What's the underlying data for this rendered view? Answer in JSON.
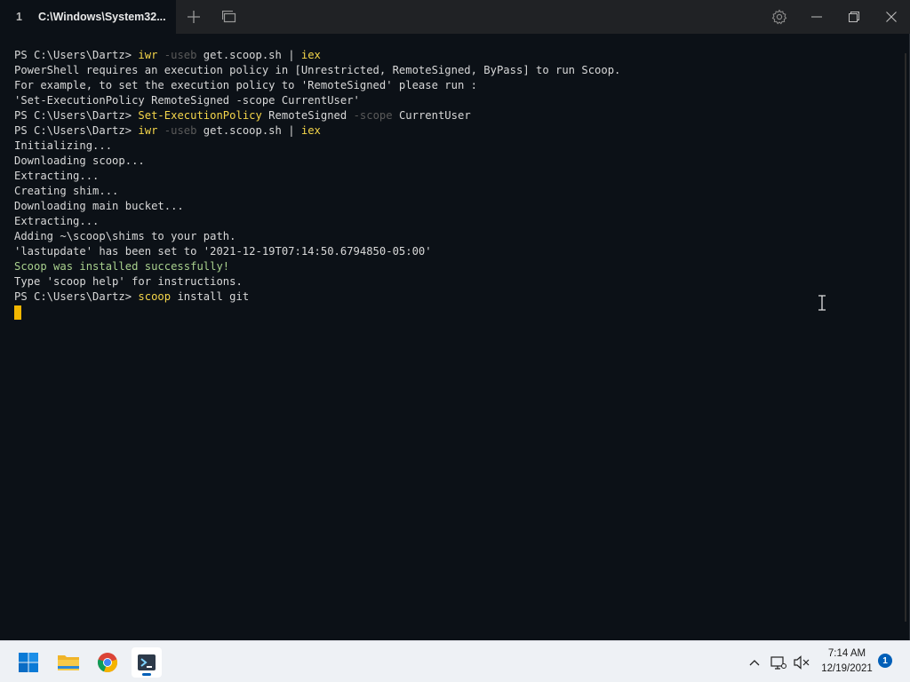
{
  "window": {
    "tab": {
      "index": "1",
      "title": "C:\\Windows\\System32..."
    }
  },
  "terminal": {
    "lines": [
      [
        {
          "t": "PS C:\\Users\\Dartz> ",
          "c": "white"
        },
        {
          "t": "iwr",
          "c": "cmd"
        },
        {
          "t": " -useb",
          "c": "grey"
        },
        {
          "t": " get.scoop.sh | ",
          "c": "white"
        },
        {
          "t": "iex",
          "c": "cmd"
        }
      ],
      [
        {
          "t": "PowerShell requires an execution policy in [Unrestricted, RemoteSigned, ByPass] to run Scoop.",
          "c": "white"
        }
      ],
      [
        {
          "t": "For example, to set the execution policy to 'RemoteSigned' please run :",
          "c": "white"
        }
      ],
      [
        {
          "t": "'Set-ExecutionPolicy RemoteSigned -scope CurrentUser'",
          "c": "white"
        }
      ],
      [
        {
          "t": "PS C:\\Users\\Dartz> ",
          "c": "white"
        },
        {
          "t": "Set-ExecutionPolicy",
          "c": "cmd"
        },
        {
          "t": " RemoteSigned ",
          "c": "white"
        },
        {
          "t": "-scope",
          "c": "grey"
        },
        {
          "t": " CurrentUser",
          "c": "white"
        }
      ],
      [
        {
          "t": "PS C:\\Users\\Dartz> ",
          "c": "white"
        },
        {
          "t": "iwr",
          "c": "cmd"
        },
        {
          "t": " -useb",
          "c": "grey"
        },
        {
          "t": " get.scoop.sh | ",
          "c": "white"
        },
        {
          "t": "iex",
          "c": "cmd"
        }
      ],
      [
        {
          "t": "Initializing...",
          "c": "white"
        }
      ],
      [
        {
          "t": "Downloading scoop...",
          "c": "white"
        }
      ],
      [
        {
          "t": "Extracting...",
          "c": "white"
        }
      ],
      [
        {
          "t": "Creating shim...",
          "c": "white"
        }
      ],
      [
        {
          "t": "Downloading main bucket...",
          "c": "white"
        }
      ],
      [
        {
          "t": "Extracting...",
          "c": "white"
        }
      ],
      [
        {
          "t": "Adding ~\\scoop\\shims to your path.",
          "c": "white"
        }
      ],
      [
        {
          "t": "'lastupdate' has been set to '2021-12-19T07:14:50.6794850-05:00'",
          "c": "white"
        }
      ],
      [
        {
          "t": "Scoop was installed successfully!",
          "c": "green"
        }
      ],
      [
        {
          "t": "Type 'scoop help' for instructions.",
          "c": "white"
        }
      ],
      [
        {
          "t": "PS C:\\Users\\Dartz> ",
          "c": "white"
        },
        {
          "t": "scoop",
          "c": "cmd"
        },
        {
          "t": " install git",
          "c": "white"
        }
      ]
    ],
    "cursor_color": "#f2b600"
  },
  "taskbar": {
    "apps": [
      "start-icon",
      "file-explorer-icon",
      "chrome-icon",
      "terminal-icon"
    ],
    "clock_time": "7:14 AM",
    "clock_date": "12/19/2021",
    "notification_count": "1"
  }
}
